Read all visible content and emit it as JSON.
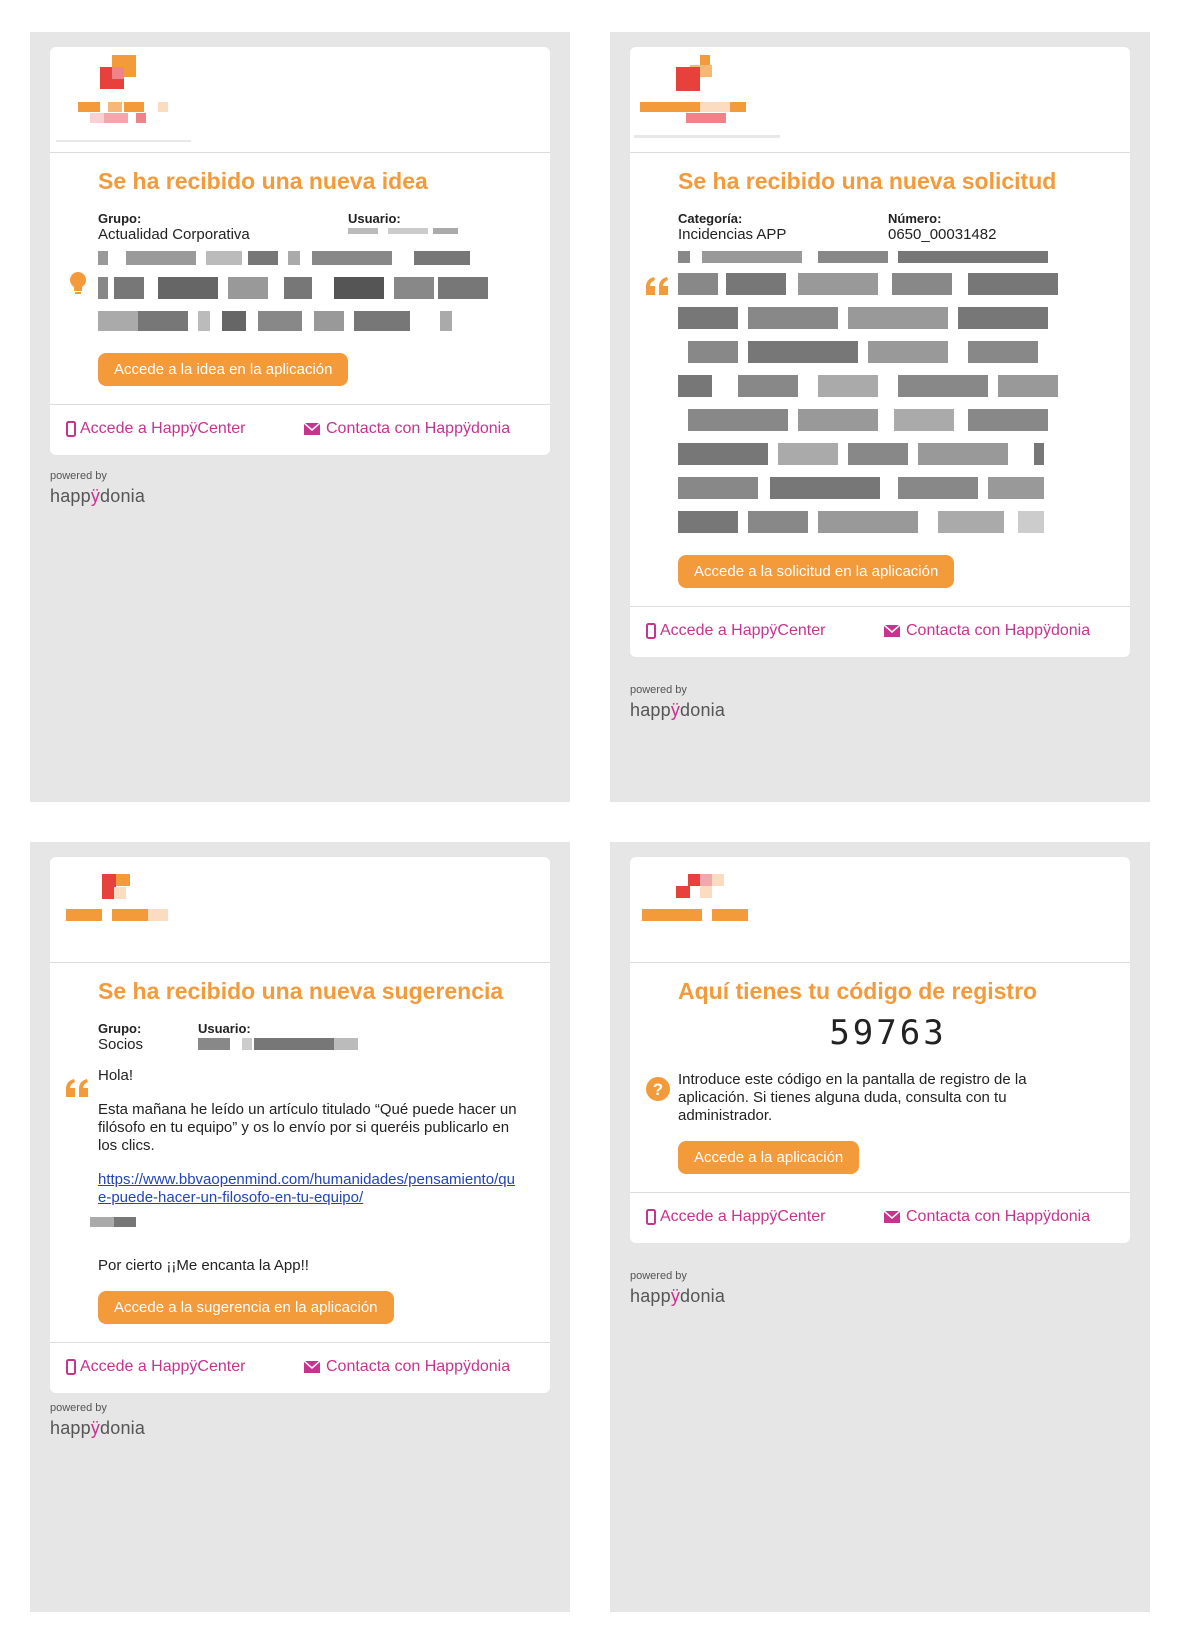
{
  "emails": [
    {
      "title": "Se ha recibido una nueva idea",
      "label_a": "Grupo:",
      "value_a": "Actualidad Corporativa",
      "label_b": "Usuario:",
      "value_b": "",
      "button": "Accede a la idea en la aplicación",
      "icon": "lightbulb-icon"
    },
    {
      "title": "Se ha recibido una nueva solicitud",
      "label_a": "Categoría:",
      "value_a": "Incidencias APP",
      "label_b": "Número:",
      "value_b": "0650_00031482",
      "button": "Accede a la solicitud en la aplicación",
      "icon": "quote-icon"
    },
    {
      "title": "Se ha recibido una nueva sugerencia",
      "label_a": "Grupo:",
      "value_a": "Socios",
      "label_b": "Usuario:",
      "value_b": "",
      "greeting": "Hola!",
      "paragraph": "Esta mañana he leído un artículo titulado “Qué puede hacer un filósofo en tu equipo” y os lo envío por si queréis publicarlo en los clics.",
      "url": "https://www.bbvaopenmind.com/humanidades/pensamiento/que-puede-hacer-un-filosofo-en-tu-equipo/",
      "closing": "Por cierto ¡¡Me encanta la App!!",
      "button": "Accede a la sugerencia en la aplicación",
      "icon": "quote-icon"
    },
    {
      "title": "Aquí tienes tu código de registro",
      "code": "59763",
      "instructions": "Introduce este código en la pantalla de registro de la aplicación. Si tienes alguna duda, consulta con tu administrador.",
      "button": "Accede a la aplicación",
      "icon": "question-circle-icon"
    }
  ],
  "footer": {
    "happycenter_link": "Accede a HappÿCenter",
    "contact_link": "Contacta con Happÿdonia"
  },
  "powered_by": "powered by",
  "brand": {
    "pre": "happ",
    "mid": "ÿ",
    "post": "donia"
  },
  "colors": {
    "accent": "#f39a3b",
    "link": "#c8338f",
    "panel": "#e6e6e6"
  }
}
